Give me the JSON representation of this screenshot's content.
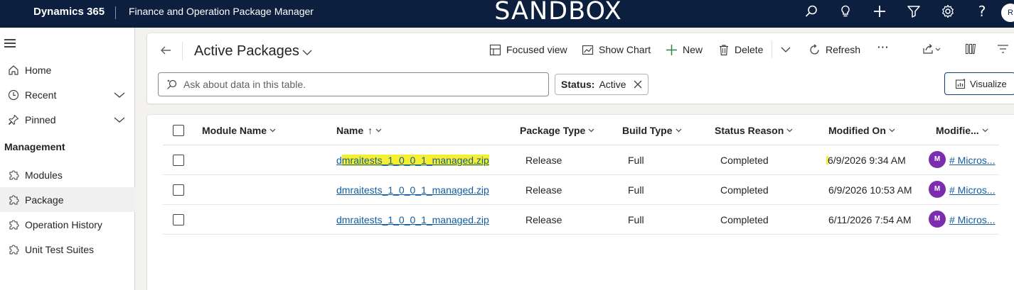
{
  "topbar": {
    "app_name": "Dynamics 365",
    "app_subtitle": "Finance and Operation Package Manager",
    "environment_banner": "SANDBOX",
    "icons": [
      "search-icon",
      "lightbulb-icon",
      "plus-icon",
      "filter-icon",
      "gear-icon",
      "help-icon"
    ],
    "user_initial": "R",
    "background": "#0c1f3e"
  },
  "sidebar": {
    "items": [
      {
        "label": "Home",
        "icon": "home-icon"
      },
      {
        "label": "Recent",
        "icon": "clock-icon"
      },
      {
        "label": "Pinned",
        "icon": "pin-icon"
      }
    ],
    "section_label": "Management",
    "management_items": [
      {
        "label": "Modules",
        "icon": "puzzle-icon"
      },
      {
        "label": "Package",
        "icon": "puzzle-icon",
        "selected": true
      },
      {
        "label": "Operation History",
        "icon": "puzzle-icon"
      },
      {
        "label": "Unit Test Suites",
        "icon": "puzzle-icon"
      }
    ]
  },
  "command_bar": {
    "view_title": "Active Packages",
    "focused_view": "Focused view",
    "show_chart": "Show Chart",
    "new": "New",
    "delete": "Delete",
    "refresh": "Refresh",
    "more": "⋯"
  },
  "search": {
    "placeholder": "Ask about data in this table."
  },
  "filter": {
    "label": "Status:",
    "value": "Active"
  },
  "visualize": {
    "label": "Visualize"
  },
  "grid": {
    "columns": [
      "Module Name",
      "Name",
      "Package Type",
      "Build Type",
      "Status Reason",
      "Modified On",
      "Modifie..."
    ],
    "name_sort_indicator": "↑",
    "rows": [
      {
        "module_name": "",
        "name_first": "d",
        "name_rest": "mraitests_1_0_0_1_managed.zip",
        "package_type": "Release",
        "build_type": "Full",
        "status_reason": "Completed",
        "modified_on": "6/9/2026 9:34 AM",
        "owner_initial": "M",
        "owner_link": "# Micros..."
      },
      {
        "module_name": "",
        "name": "dmraitests_1_0_0_1_managed.zip",
        "package_type": "Release",
        "build_type": "Full",
        "status_reason": "Completed",
        "modified_on": "6/9/2026 10:53 AM",
        "owner_initial": "M",
        "owner_link": "# Micros..."
      },
      {
        "module_name": "",
        "name": "dmraitests_1_0_0_1_managed.zip",
        "package_type": "Release",
        "build_type": "Full",
        "status_reason": "Completed",
        "modified_on": "6/11/2026 7:54 AM",
        "owner_initial": "M",
        "owner_link": "# Micros..."
      }
    ],
    "highlight_color": "#f5ef2f",
    "link_color": "#115ea3",
    "avatar_color": "#7c2cae"
  }
}
